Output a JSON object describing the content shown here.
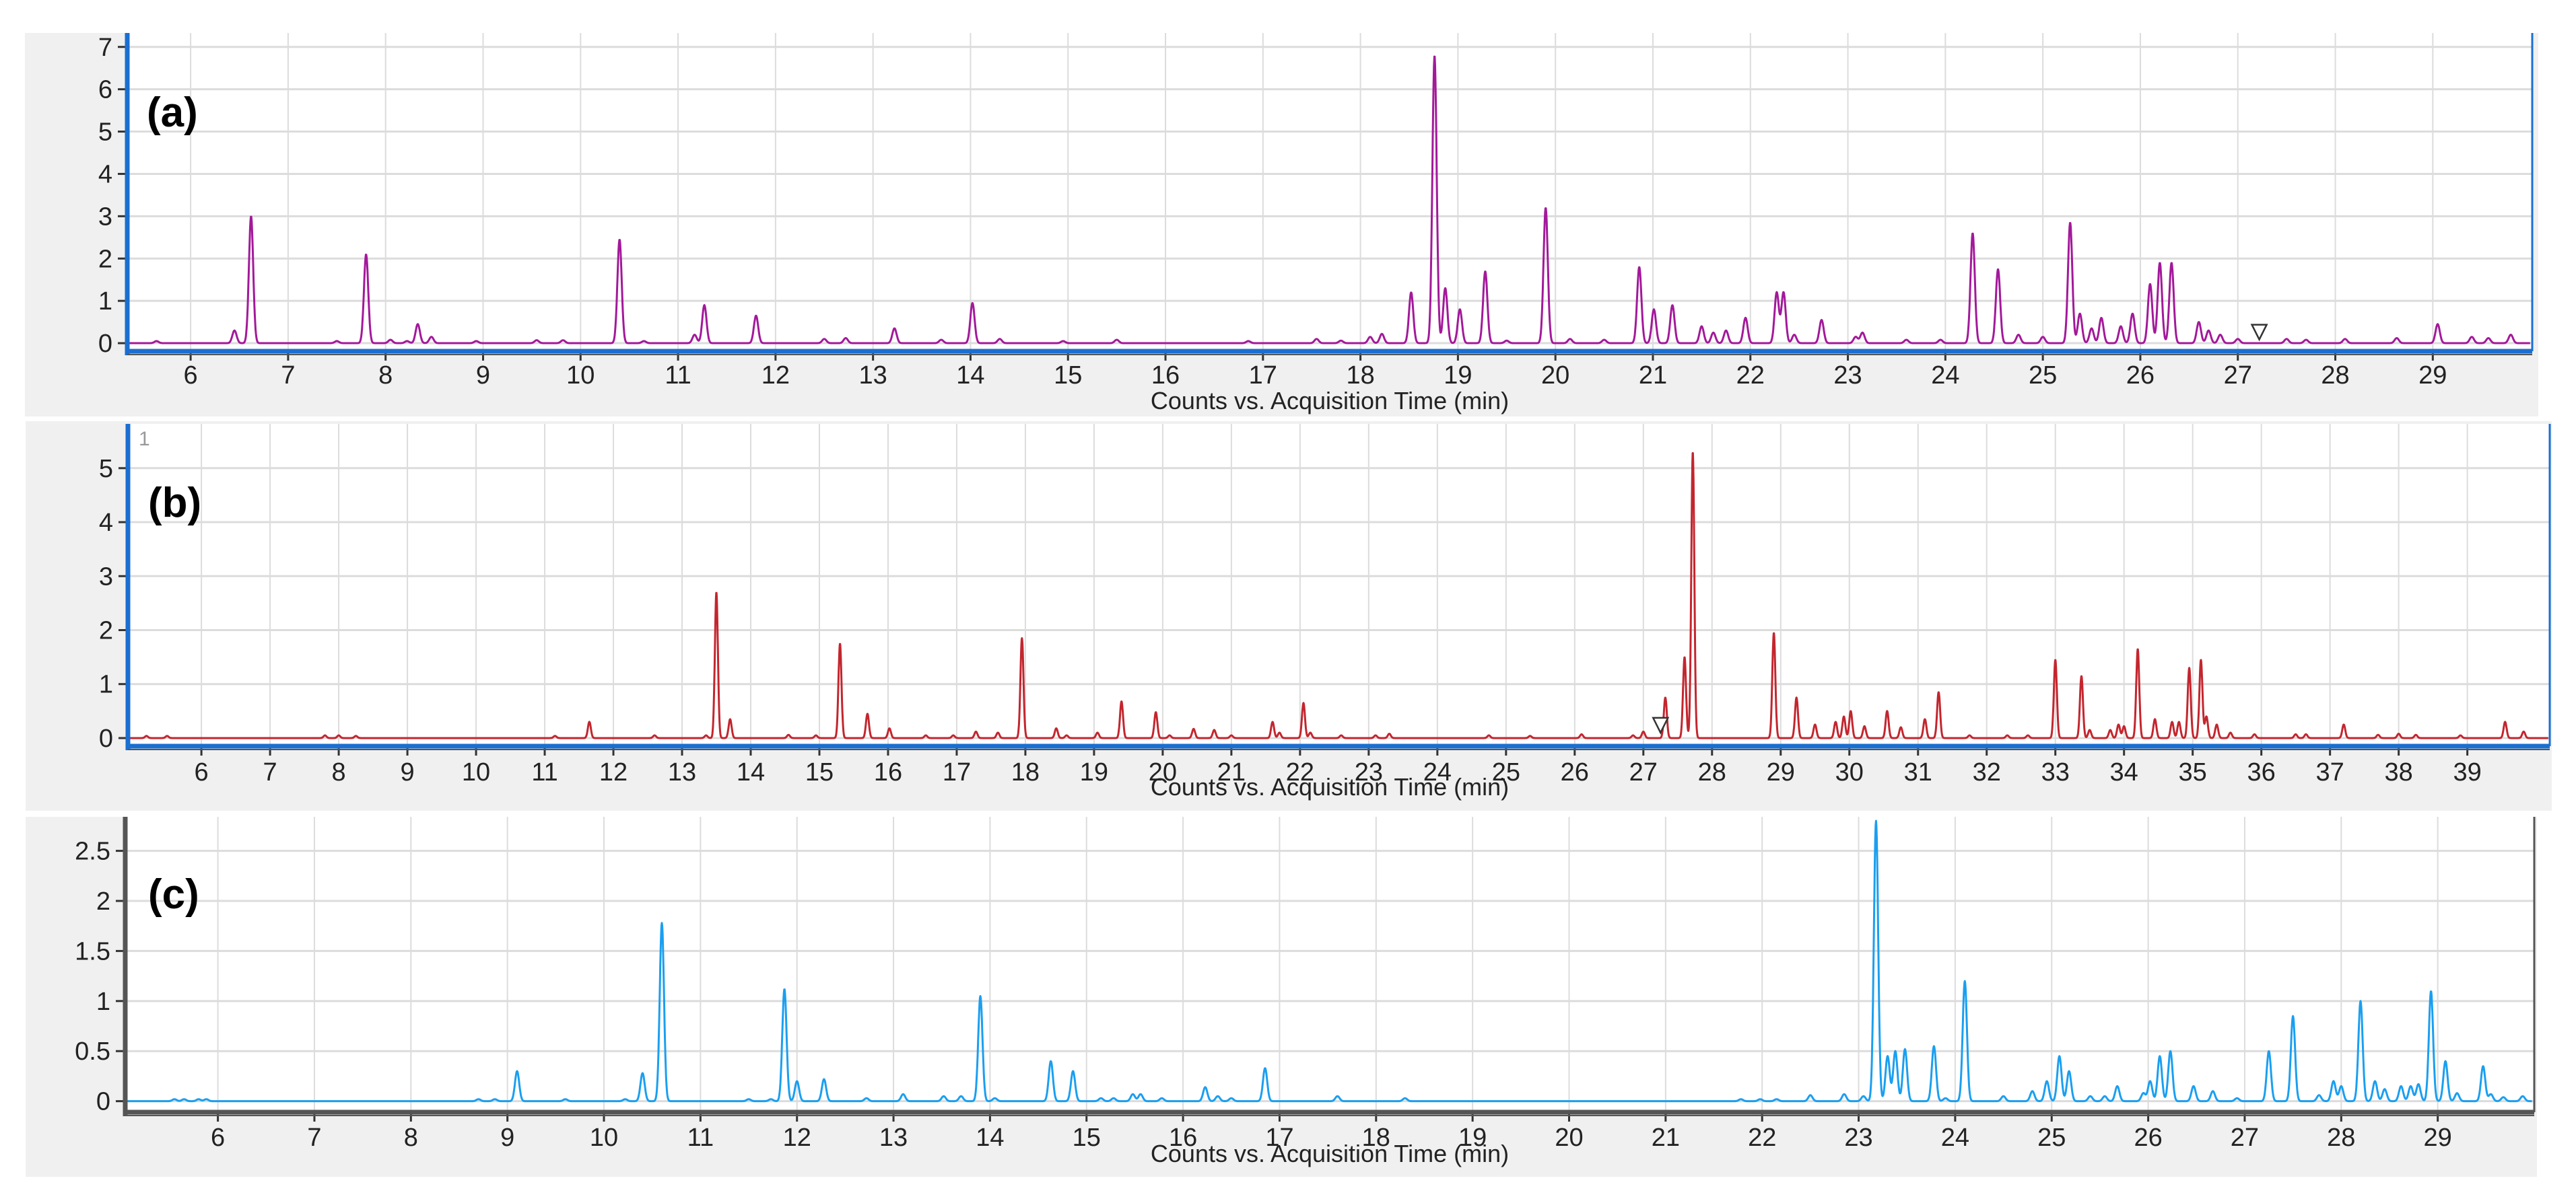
{
  "chart_data": [
    {
      "type": "line",
      "panel_label": "(a)",
      "xlabel": "Counts vs. Acquisition Time (min)",
      "ylabel": "",
      "xlim": [
        5.35,
        30.02
      ],
      "ylim": [
        -0.19,
        7.33
      ],
      "xticks": [
        6,
        7,
        8,
        9,
        10,
        11,
        12,
        13,
        14,
        15,
        16,
        17,
        18,
        19,
        20,
        21,
        22,
        23,
        24,
        25,
        26,
        27,
        28,
        29
      ],
      "yticks": [
        0,
        1,
        2,
        3,
        4,
        5,
        6,
        7
      ],
      "grid": true,
      "color": "#a3199a",
      "marker_rt": 27.22,
      "peaks": [
        [
          5.65,
          0.05
        ],
        [
          6.45,
          0.3
        ],
        [
          6.62,
          3.0
        ],
        [
          7.5,
          0.05
        ],
        [
          7.8,
          2.1
        ],
        [
          8.05,
          0.08
        ],
        [
          8.22,
          0.05
        ],
        [
          8.33,
          0.45
        ],
        [
          8.47,
          0.15
        ],
        [
          8.93,
          0.05
        ],
        [
          9.55,
          0.07
        ],
        [
          9.82,
          0.07
        ],
        [
          10.4,
          2.45
        ],
        [
          10.65,
          0.05
        ],
        [
          11.17,
          0.2
        ],
        [
          11.27,
          0.9
        ],
        [
          11.8,
          0.65
        ],
        [
          12.5,
          0.1
        ],
        [
          12.72,
          0.12
        ],
        [
          13.22,
          0.35
        ],
        [
          13.7,
          0.08
        ],
        [
          14.02,
          0.95
        ],
        [
          14.3,
          0.1
        ],
        [
          14.95,
          0.05
        ],
        [
          15.5,
          0.08
        ],
        [
          16.85,
          0.05
        ],
        [
          17.55,
          0.1
        ],
        [
          17.8,
          0.06
        ],
        [
          18.1,
          0.15
        ],
        [
          18.22,
          0.22
        ],
        [
          18.52,
          1.2
        ],
        [
          18.76,
          6.8
        ],
        [
          18.87,
          1.3
        ],
        [
          19.02,
          0.8
        ],
        [
          19.28,
          1.7
        ],
        [
          19.5,
          0.06
        ],
        [
          19.9,
          3.2
        ],
        [
          20.15,
          0.1
        ],
        [
          20.5,
          0.08
        ],
        [
          20.86,
          1.8
        ],
        [
          21.01,
          0.8
        ],
        [
          21.2,
          0.9
        ],
        [
          21.5,
          0.4
        ],
        [
          21.62,
          0.25
        ],
        [
          21.75,
          0.3
        ],
        [
          21.95,
          0.6
        ],
        [
          22.27,
          1.2
        ],
        [
          22.34,
          1.2
        ],
        [
          22.45,
          0.2
        ],
        [
          22.73,
          0.55
        ],
        [
          23.08,
          0.15
        ],
        [
          23.15,
          0.25
        ],
        [
          23.6,
          0.08
        ],
        [
          23.95,
          0.08
        ],
        [
          24.28,
          2.6
        ],
        [
          24.54,
          1.75
        ],
        [
          24.75,
          0.2
        ],
        [
          25.0,
          0.15
        ],
        [
          25.28,
          2.85
        ],
        [
          25.38,
          0.7
        ],
        [
          25.5,
          0.35
        ],
        [
          25.6,
          0.6
        ],
        [
          25.8,
          0.4
        ],
        [
          25.92,
          0.7
        ],
        [
          26.1,
          1.4
        ],
        [
          26.2,
          1.9
        ],
        [
          26.32,
          1.9
        ],
        [
          26.6,
          0.5
        ],
        [
          26.7,
          0.3
        ],
        [
          26.82,
          0.2
        ],
        [
          27.0,
          0.1
        ],
        [
          27.5,
          0.1
        ],
        [
          27.7,
          0.08
        ],
        [
          28.1,
          0.1
        ],
        [
          28.63,
          0.12
        ],
        [
          29.05,
          0.45
        ],
        [
          29.4,
          0.15
        ],
        [
          29.57,
          0.12
        ],
        [
          29.8,
          0.2
        ]
      ]
    },
    {
      "type": "line",
      "panel_label": "(b)",
      "trace_index_label": "1",
      "xlabel": "Counts vs. Acquisition Time (min)",
      "ylabel": "",
      "xlim": [
        4.93,
        40.2
      ],
      "ylim": [
        -0.15,
        5.82
      ],
      "xticks": [
        6,
        7,
        8,
        9,
        10,
        11,
        12,
        13,
        14,
        15,
        16,
        17,
        18,
        19,
        20,
        21,
        22,
        23,
        24,
        25,
        26,
        27,
        28,
        29,
        30,
        31,
        32,
        33,
        34,
        35,
        36,
        37,
        38,
        39
      ],
      "yticks": [
        0,
        1,
        2,
        3,
        4,
        5
      ],
      "grid": true,
      "color": "#c3262e",
      "marker_rt": 27.25,
      "peaks": [
        [
          5.2,
          0.04
        ],
        [
          5.5,
          0.04
        ],
        [
          7.8,
          0.05
        ],
        [
          8.0,
          0.05
        ],
        [
          8.25,
          0.04
        ],
        [
          11.15,
          0.04
        ],
        [
          11.65,
          0.3
        ],
        [
          12.6,
          0.05
        ],
        [
          13.35,
          0.05
        ],
        [
          13.5,
          2.7
        ],
        [
          13.7,
          0.35
        ],
        [
          14.55,
          0.06
        ],
        [
          14.95,
          0.05
        ],
        [
          15.3,
          1.75
        ],
        [
          15.7,
          0.45
        ],
        [
          16.02,
          0.18
        ],
        [
          16.55,
          0.05
        ],
        [
          16.95,
          0.05
        ],
        [
          17.28,
          0.12
        ],
        [
          17.6,
          0.1
        ],
        [
          17.95,
          1.85
        ],
        [
          18.45,
          0.18
        ],
        [
          18.6,
          0.05
        ],
        [
          19.05,
          0.1
        ],
        [
          19.4,
          0.68
        ],
        [
          19.9,
          0.48
        ],
        [
          20.1,
          0.05
        ],
        [
          20.45,
          0.17
        ],
        [
          20.75,
          0.15
        ],
        [
          21.0,
          0.05
        ],
        [
          21.6,
          0.3
        ],
        [
          21.7,
          0.1
        ],
        [
          22.05,
          0.65
        ],
        [
          22.15,
          0.1
        ],
        [
          22.6,
          0.05
        ],
        [
          23.1,
          0.05
        ],
        [
          23.3,
          0.08
        ],
        [
          24.75,
          0.05
        ],
        [
          25.35,
          0.04
        ],
        [
          26.1,
          0.07
        ],
        [
          26.85,
          0.05
        ],
        [
          27.0,
          0.12
        ],
        [
          27.32,
          0.75
        ],
        [
          27.6,
          1.5
        ],
        [
          27.72,
          5.3
        ],
        [
          28.9,
          1.95
        ],
        [
          29.23,
          0.75
        ],
        [
          29.5,
          0.25
        ],
        [
          29.8,
          0.3
        ],
        [
          29.92,
          0.4
        ],
        [
          30.02,
          0.5
        ],
        [
          30.22,
          0.22
        ],
        [
          30.55,
          0.5
        ],
        [
          30.75,
          0.2
        ],
        [
          31.1,
          0.35
        ],
        [
          31.3,
          0.85
        ],
        [
          31.75,
          0.05
        ],
        [
          32.3,
          0.05
        ],
        [
          32.6,
          0.05
        ],
        [
          33.0,
          1.45
        ],
        [
          33.38,
          1.15
        ],
        [
          33.5,
          0.15
        ],
        [
          33.8,
          0.15
        ],
        [
          33.92,
          0.25
        ],
        [
          34.0,
          0.22
        ],
        [
          34.2,
          1.65
        ],
        [
          34.45,
          0.35
        ],
        [
          34.7,
          0.3
        ],
        [
          34.8,
          0.3
        ],
        [
          34.95,
          1.3
        ],
        [
          35.12,
          1.45
        ],
        [
          35.2,
          0.4
        ],
        [
          35.35,
          0.25
        ],
        [
          35.55,
          0.1
        ],
        [
          35.9,
          0.07
        ],
        [
          36.5,
          0.07
        ],
        [
          36.65,
          0.07
        ],
        [
          37.2,
          0.25
        ],
        [
          37.7,
          0.06
        ],
        [
          38.0,
          0.08
        ],
        [
          38.25,
          0.06
        ],
        [
          38.9,
          0.05
        ],
        [
          39.55,
          0.3
        ],
        [
          39.82,
          0.12
        ]
      ]
    },
    {
      "type": "line",
      "panel_label": "(c)",
      "xlabel": "Counts vs. Acquisition Time (min)",
      "ylabel": "",
      "xlim": [
        5.04,
        30.0
      ],
      "ylim": [
        -0.11,
        2.84
      ],
      "xticks": [
        6,
        7,
        8,
        9,
        10,
        11,
        12,
        13,
        14,
        15,
        16,
        17,
        18,
        19,
        20,
        21,
        22,
        23,
        24,
        25,
        26,
        27,
        28,
        29
      ],
      "yticks": [
        0,
        0.5,
        1,
        1.5,
        2,
        2.5
      ],
      "grid": true,
      "color": "#1a9ff0",
      "peaks": [
        [
          5.55,
          0.02
        ],
        [
          5.65,
          0.02
        ],
        [
          5.8,
          0.02
        ],
        [
          5.88,
          0.02
        ],
        [
          8.7,
          0.02
        ],
        [
          8.87,
          0.02
        ],
        [
          9.1,
          0.3
        ],
        [
          9.6,
          0.02
        ],
        [
          10.22,
          0.02
        ],
        [
          10.4,
          0.28
        ],
        [
          10.6,
          1.78
        ],
        [
          11.5,
          0.02
        ],
        [
          11.73,
          0.02
        ],
        [
          11.87,
          1.12
        ],
        [
          12.0,
          0.2
        ],
        [
          12.28,
          0.22
        ],
        [
          12.72,
          0.03
        ],
        [
          13.1,
          0.07
        ],
        [
          13.52,
          0.05
        ],
        [
          13.7,
          0.05
        ],
        [
          13.9,
          1.05
        ],
        [
          14.05,
          0.03
        ],
        [
          14.63,
          0.4
        ],
        [
          14.86,
          0.3
        ],
        [
          15.15,
          0.03
        ],
        [
          15.28,
          0.03
        ],
        [
          15.48,
          0.07
        ],
        [
          15.56,
          0.07
        ],
        [
          15.78,
          0.03
        ],
        [
          16.23,
          0.14
        ],
        [
          16.36,
          0.05
        ],
        [
          16.5,
          0.03
        ],
        [
          16.85,
          0.33
        ],
        [
          17.6,
          0.05
        ],
        [
          18.3,
          0.03
        ],
        [
          21.78,
          0.02
        ],
        [
          21.98,
          0.02
        ],
        [
          22.15,
          0.02
        ],
        [
          22.5,
          0.06
        ],
        [
          22.85,
          0.07
        ],
        [
          23.05,
          0.05
        ],
        [
          23.18,
          2.8
        ],
        [
          23.3,
          0.45
        ],
        [
          23.38,
          0.5
        ],
        [
          23.48,
          0.52
        ],
        [
          23.78,
          0.55
        ],
        [
          23.9,
          0.03
        ],
        [
          24.1,
          1.2
        ],
        [
          24.5,
          0.05
        ],
        [
          24.8,
          0.1
        ],
        [
          24.95,
          0.2
        ],
        [
          25.08,
          0.45
        ],
        [
          25.18,
          0.3
        ],
        [
          25.4,
          0.05
        ],
        [
          25.55,
          0.05
        ],
        [
          25.68,
          0.15
        ],
        [
          25.95,
          0.08
        ],
        [
          26.02,
          0.2
        ],
        [
          26.12,
          0.45
        ],
        [
          26.23,
          0.5
        ],
        [
          26.47,
          0.15
        ],
        [
          26.67,
          0.1
        ],
        [
          26.92,
          0.03
        ],
        [
          27.25,
          0.5
        ],
        [
          27.5,
          0.85
        ],
        [
          27.77,
          0.06
        ],
        [
          27.92,
          0.2
        ],
        [
          28.0,
          0.15
        ],
        [
          28.2,
          1.0
        ],
        [
          28.35,
          0.2
        ],
        [
          28.45,
          0.12
        ],
        [
          28.62,
          0.15
        ],
        [
          28.72,
          0.15
        ],
        [
          28.8,
          0.17
        ],
        [
          28.93,
          1.1
        ],
        [
          29.08,
          0.4
        ],
        [
          29.2,
          0.08
        ],
        [
          29.47,
          0.35
        ],
        [
          29.55,
          0.07
        ],
        [
          29.68,
          0.04
        ],
        [
          29.88,
          0.05
        ]
      ]
    }
  ]
}
